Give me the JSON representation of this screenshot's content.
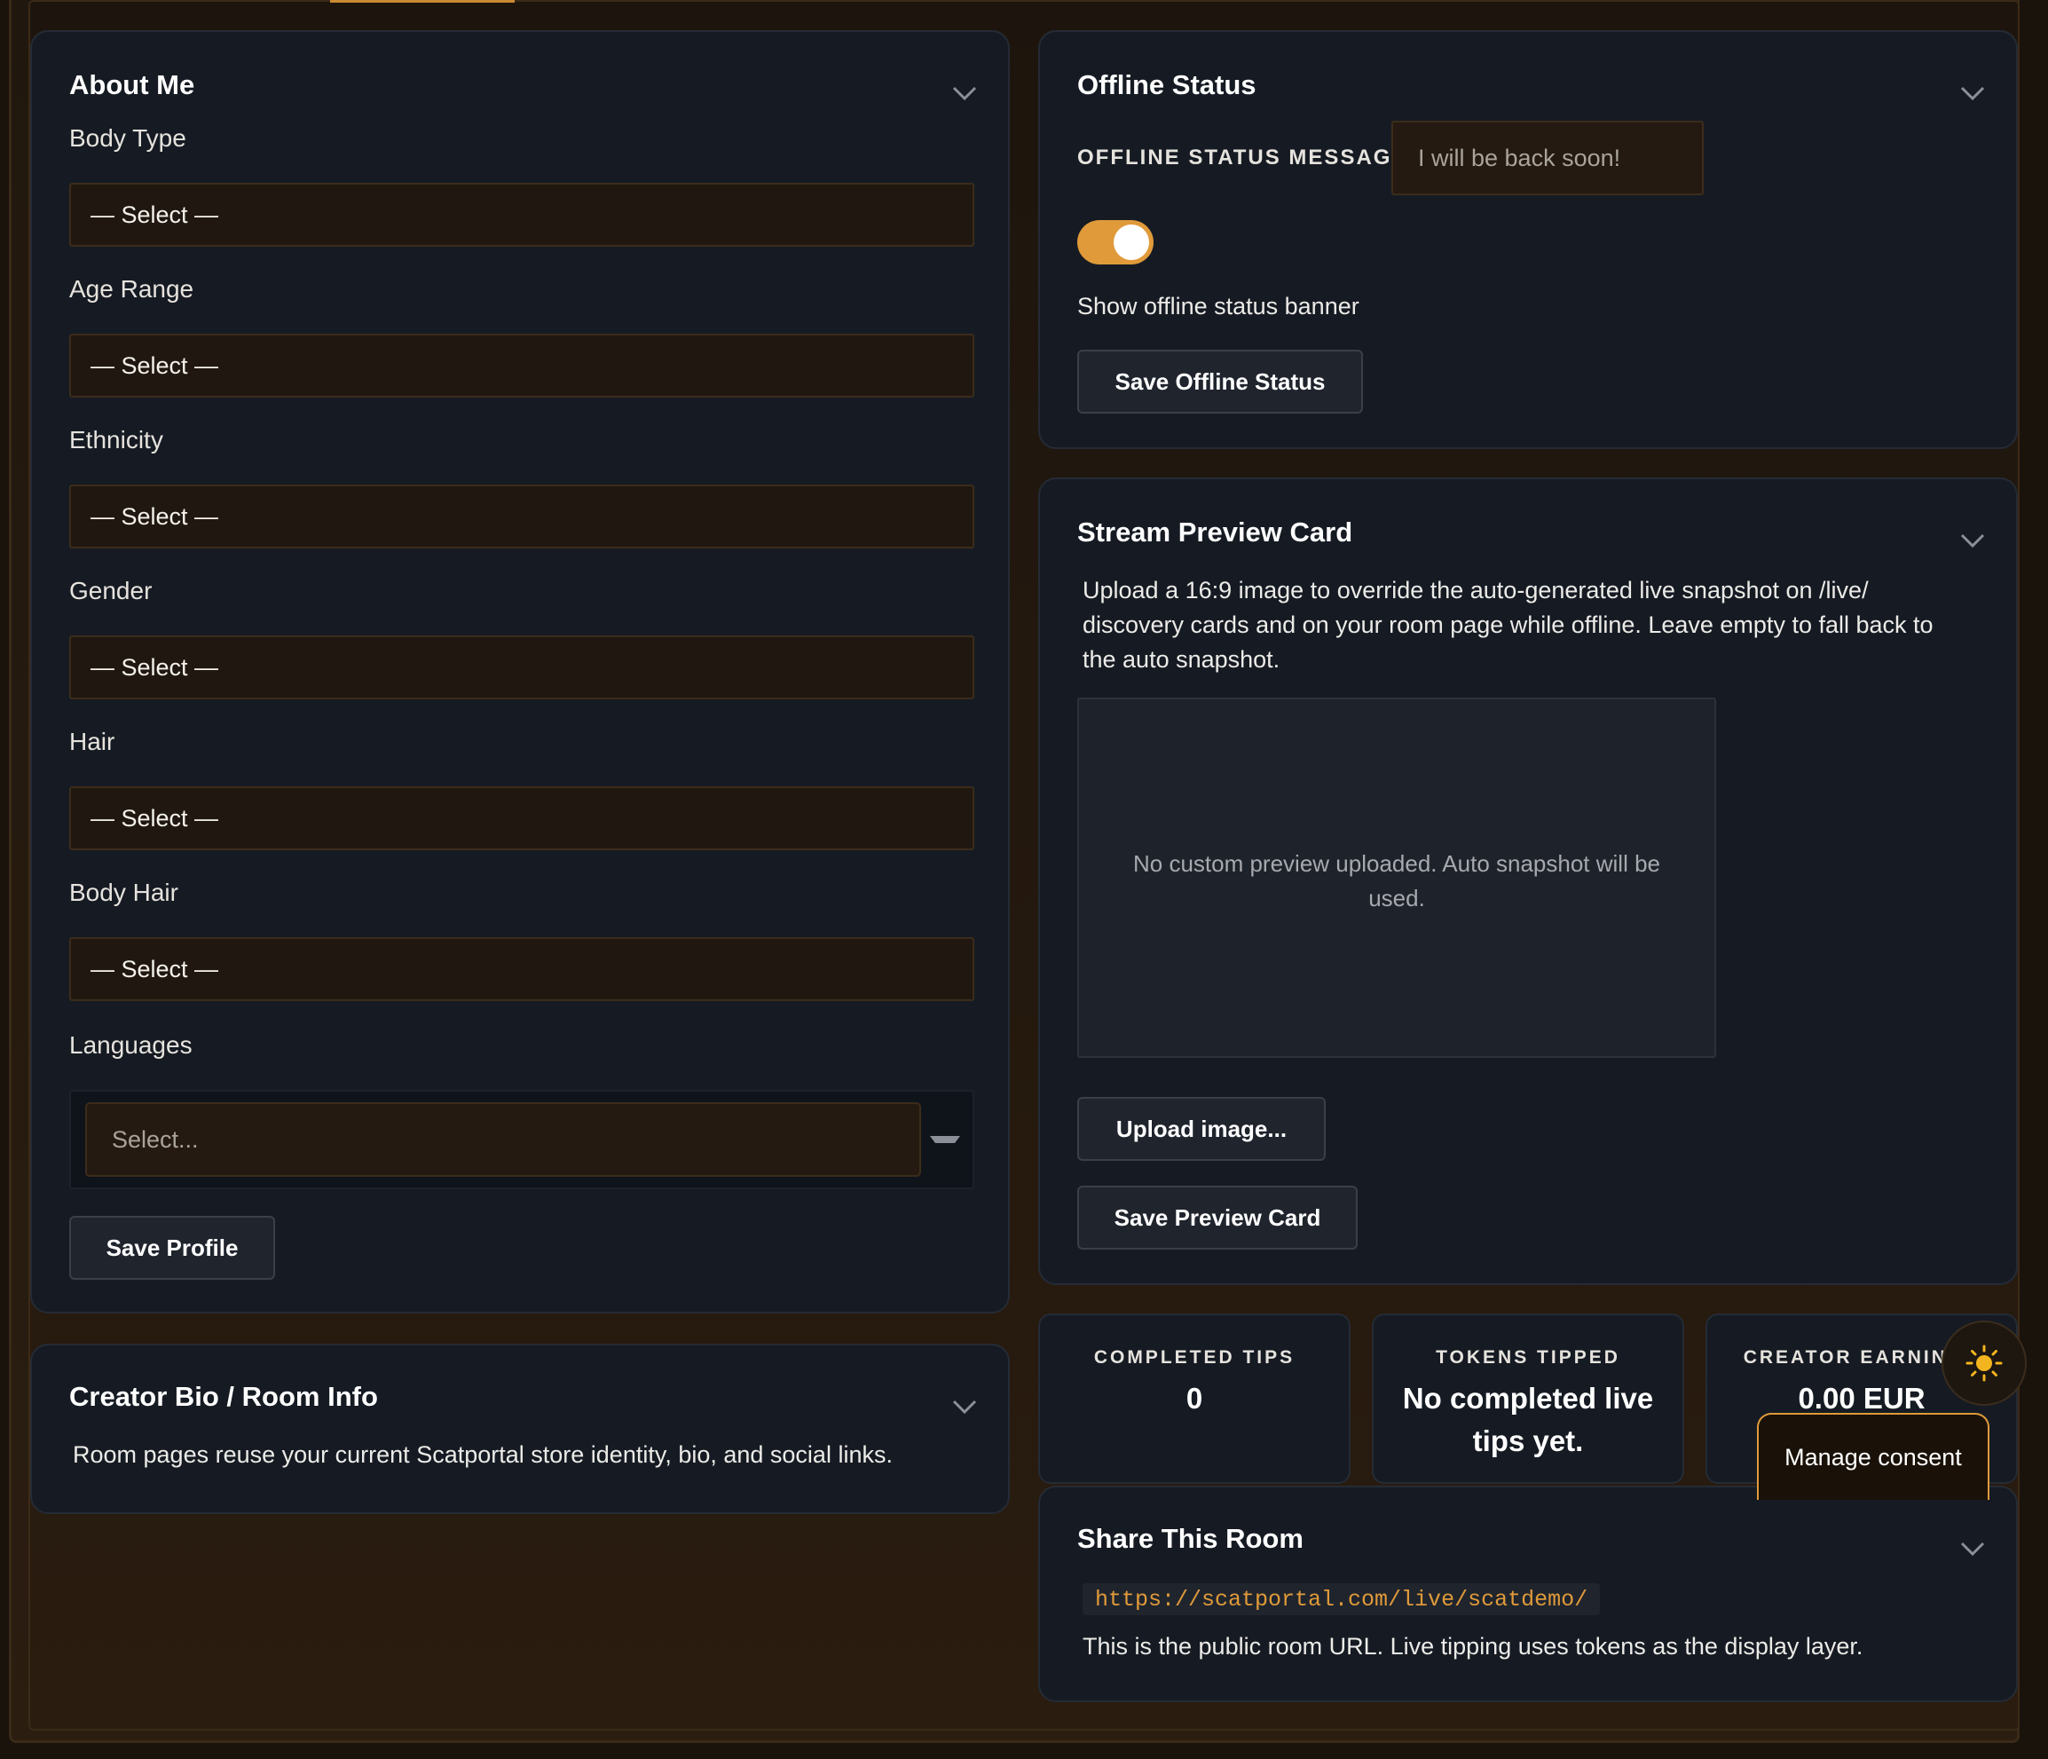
{
  "about": {
    "title": "About Me",
    "fields": [
      {
        "label": "Body Type",
        "value": "— Select —"
      },
      {
        "label": "Age Range",
        "value": "— Select —"
      },
      {
        "label": "Ethnicity",
        "value": "— Select —"
      },
      {
        "label": "Gender",
        "value": "— Select —"
      },
      {
        "label": "Hair",
        "value": "— Select —"
      },
      {
        "label": "Body Hair",
        "value": "— Select —"
      }
    ],
    "languages_label": "Languages",
    "languages_placeholder": "Select...",
    "save_label": "Save Profile"
  },
  "bio": {
    "title": "Creator Bio / Room Info",
    "text": "Room pages reuse your current Scatportal store identity, bio, and social links."
  },
  "offline": {
    "title": "Offline Status",
    "message_label": "OFFLINE STATUS MESSAGE",
    "message_placeholder": "I will be back soon!",
    "toggle_on": true,
    "toggle_label": "Show offline status banner",
    "save_label": "Save Offline Status"
  },
  "preview": {
    "title": "Stream Preview Card",
    "description_lines": [
      "Upload a 16:9 image to override the auto-generated live snapshot on /live/",
      "discovery cards and on your room page while offline. Leave empty to fall back to",
      "the auto snapshot."
    ],
    "empty_lines": [
      "No custom preview uploaded. Auto snapshot will be",
      "used."
    ],
    "upload_label": "Upload image...",
    "save_label": "Save Preview Card"
  },
  "stats": [
    {
      "label": "COMPLETED TIPS",
      "value_lines": [
        "0"
      ]
    },
    {
      "label": "TOKENS TIPPED",
      "value_lines": [
        "No completed live",
        "tips yet."
      ]
    },
    {
      "label": "CREATOR EARNINGS",
      "value_lines": [
        "0.00 EUR"
      ]
    }
  ],
  "share": {
    "title": "Share This Room",
    "url": "https://scatportal.com/live/scatdemo/",
    "text": "This is the public room URL. Live tipping uses tokens as the display layer."
  },
  "consent": {
    "label": "Manage consent"
  },
  "theme_toggle": {
    "icon": "sun-icon"
  },
  "colors": {
    "accent": "#e09a3a",
    "card_bg": "#161b23",
    "page_bg": "#1a130c"
  }
}
